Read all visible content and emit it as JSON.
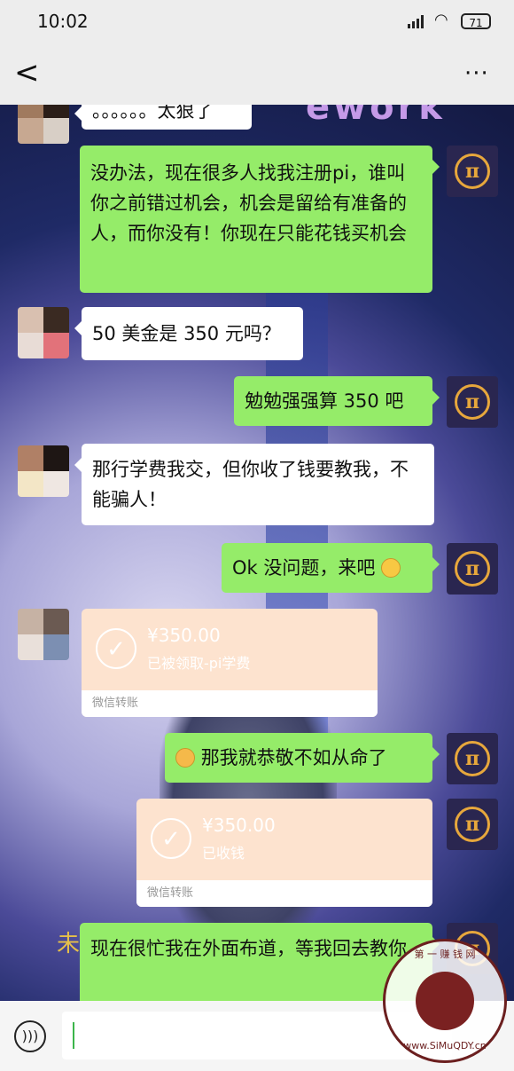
{
  "status_bar": {
    "time": "10:02",
    "battery": "71"
  },
  "title_bar": {
    "back": "<",
    "title": "",
    "more": "···"
  },
  "background": {
    "top_word": "ework",
    "bottom_text": "未"
  },
  "messages": [
    {
      "side": "left",
      "text": "。。。。。。太狠了"
    },
    {
      "side": "right",
      "text": "没办法，现在很多人找我注册pi，谁叫你之前错过机会，机会是留给有准备的人，而你没有！你现在只能花钱买机会"
    },
    {
      "side": "left",
      "text": "50 美金是 350 元吗？"
    },
    {
      "side": "right",
      "text": "勉勉强强算 350 吧"
    },
    {
      "side": "left",
      "text": "那行学费我交，但你收了钱要教我，不能骗人！"
    },
    {
      "side": "right",
      "text": "Ok 没问题，来吧"
    },
    {
      "side": "left",
      "type": "transfer",
      "amount": "¥350.00",
      "note": "已被领取-pi学费",
      "label": "微信转账"
    },
    {
      "side": "right",
      "text": "那我就恭敬不如从命了"
    },
    {
      "side": "right",
      "type": "transfer",
      "amount": "¥350.00",
      "note": "已收钱",
      "label": "微信转账"
    },
    {
      "side": "right",
      "text": "现在很忙我在外面布道，等我回去教你"
    }
  ],
  "input_bar": {
    "voice_icon": "speaker-icon",
    "placeholder": ""
  },
  "watermark": {
    "text": "第 一 赚 钱 网",
    "url": "www.SiMuQDY.cn"
  },
  "avatar_right_symbol": "π",
  "colors": {
    "bubble_right": "#95ec69",
    "bubble_left": "#ffffff",
    "pi_gold": "#e7a73c",
    "transfer": "#fde3cf"
  }
}
